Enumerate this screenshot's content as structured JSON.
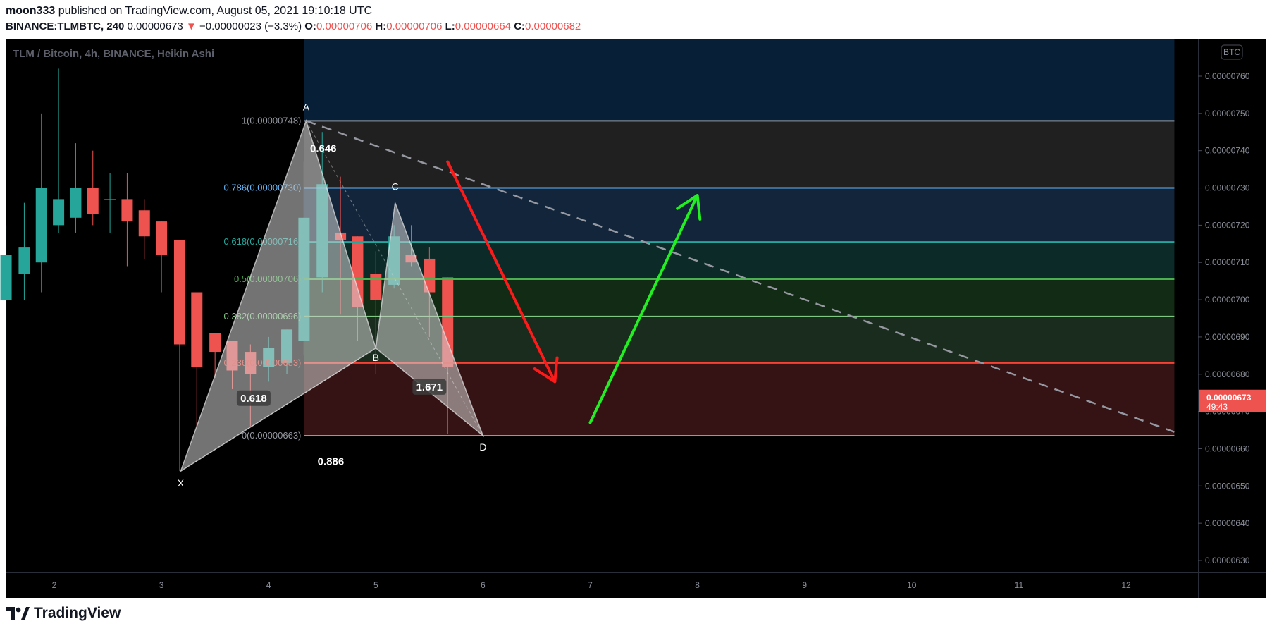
{
  "header": {
    "author": "moon333",
    "published_text": "published on TradingView.com, August 05, 2021 19:10:18 UTC",
    "symbol": "BINANCE:TLMBTC, 240",
    "last": "0.00000673",
    "change": "−0.00000023 (−3.3%)",
    "o_label": "O:",
    "o": "0.00000706",
    "h_label": "H:",
    "h": "0.00000706",
    "l_label": "L:",
    "l": "0.00000664",
    "c_label": "C:",
    "c": "0.00000682"
  },
  "footer": {
    "brand": "TradingView",
    "logo_icon": "tradingview-logo-icon"
  },
  "chart_data": {
    "type": "candlestick",
    "title": "TLM / Bitcoin, 4h, BINANCE, Heikin Ashi",
    "currency_badge": "BTC",
    "ylim": [
      6.26e-06,
      7.68e-06
    ],
    "x_ticks": [
      "2",
      "3",
      "4",
      "5",
      "6",
      "7",
      "8",
      "9",
      "10",
      "11",
      "12"
    ],
    "x_tick_days": [
      2,
      3,
      4,
      5,
      6,
      7,
      8,
      9,
      10,
      11,
      12
    ],
    "y_ticks": [
      "0.00000760",
      "0.00000750",
      "0.00000740",
      "0.00000730",
      "0.00000720",
      "0.00000710",
      "0.00000700",
      "0.00000690",
      "0.00000680",
      "0.00000670",
      "0.00000660",
      "0.00000650",
      "0.00000640",
      "0.00000630"
    ],
    "price_label": {
      "value": "0.00000673",
      "countdown": "49:43",
      "color": "#ef5350"
    },
    "candles": [
      {
        "t": 1.55,
        "o": 7.0,
        "h": 7.2,
        "l": 6.66,
        "c": 7.12
      },
      {
        "t": 1.72,
        "o": 7.07,
        "h": 7.26,
        "l": 7.0,
        "c": 7.14
      },
      {
        "t": 1.88,
        "o": 7.1,
        "h": 7.5,
        "l": 7.02,
        "c": 7.3
      },
      {
        "t": 2.04,
        "o": 7.2,
        "h": 7.62,
        "l": 7.18,
        "c": 7.27
      },
      {
        "t": 2.2,
        "o": 7.22,
        "h": 7.42,
        "l": 7.18,
        "c": 7.3
      },
      {
        "t": 2.36,
        "o": 7.3,
        "h": 7.4,
        "l": 7.2,
        "c": 7.23
      },
      {
        "t": 2.52,
        "o": 7.27,
        "h": 7.34,
        "l": 7.18,
        "c": 7.27
      },
      {
        "t": 2.68,
        "o": 7.27,
        "h": 7.34,
        "l": 7.09,
        "c": 7.21
      },
      {
        "t": 2.84,
        "o": 7.24,
        "h": 7.27,
        "l": 7.11,
        "c": 7.17
      },
      {
        "t": 3.0,
        "o": 7.21,
        "h": 7.21,
        "l": 7.02,
        "c": 7.12
      },
      {
        "t": 3.17,
        "o": 7.16,
        "h": 7.16,
        "l": 6.54,
        "c": 6.88
      },
      {
        "t": 3.33,
        "o": 7.02,
        "h": 7.02,
        "l": 6.66,
        "c": 6.82
      },
      {
        "t": 3.5,
        "o": 6.91,
        "h": 6.91,
        "l": 6.79,
        "c": 6.86
      },
      {
        "t": 3.66,
        "o": 6.89,
        "h": 6.89,
        "l": 6.76,
        "c": 6.81
      },
      {
        "t": 3.83,
        "o": 6.86,
        "h": 6.88,
        "l": 6.66,
        "c": 6.8
      },
      {
        "t": 4.0,
        "o": 6.82,
        "h": 6.9,
        "l": 6.78,
        "c": 6.87
      },
      {
        "t": 4.17,
        "o": 6.83,
        "h": 6.92,
        "l": 6.8,
        "c": 6.92
      },
      {
        "t": 4.33,
        "o": 6.89,
        "h": 7.37,
        "l": 6.85,
        "c": 7.22
      },
      {
        "t": 4.5,
        "o": 7.06,
        "h": 7.45,
        "l": 7.02,
        "c": 7.31
      },
      {
        "t": 4.67,
        "o": 7.18,
        "h": 7.33,
        "l": 6.96,
        "c": 7.16
      },
      {
        "t": 4.83,
        "o": 7.17,
        "h": 7.17,
        "l": 6.89,
        "c": 6.98
      },
      {
        "t": 5.0,
        "o": 7.07,
        "h": 7.13,
        "l": 6.8,
        "c": 7.0
      },
      {
        "t": 5.17,
        "o": 7.04,
        "h": 7.2,
        "l": 7.03,
        "c": 7.17
      },
      {
        "t": 5.33,
        "o": 7.12,
        "h": 7.2,
        "l": 7.09,
        "c": 7.1
      },
      {
        "t": 5.5,
        "o": 7.11,
        "h": 7.14,
        "l": 6.9,
        "c": 7.02
      },
      {
        "t": 5.67,
        "o": 7.06,
        "h": 7.06,
        "l": 6.64,
        "c": 6.82
      }
    ],
    "fib_levels": [
      {
        "label": "1(0.00000748)",
        "value": 7.48,
        "line": "#9598a1",
        "fill": "#202020"
      },
      {
        "label": "0.786(0.00000730)",
        "value": 7.3,
        "line": "#64b5f6",
        "fill": "#12253a"
      },
      {
        "label": "0.618(0.00000716)",
        "value": 7.155,
        "line": "#26a69a",
        "fill": "#0b2a28"
      },
      {
        "label": "0.5(0.00000706)",
        "value": 7.055,
        "line": "#4caf50",
        "fill": "#122b14"
      },
      {
        "label": "0.382(0.00000696)",
        "value": 6.955,
        "line": "#81c784",
        "fill": "#1a2c1d"
      },
      {
        "label": "0.236(0.00000683)",
        "value": 6.83,
        "line": "#f44336",
        "fill": "#351213"
      },
      {
        "label": "0(0.00000663)",
        "value": 6.635,
        "line": "#9598a1",
        "fill": null
      }
    ],
    "fib_top_fill": "#072037",
    "harmonic_points": [
      {
        "label": "X",
        "t": 3.18,
        "p": 6.54
      },
      {
        "label": "A",
        "t": 4.35,
        "p": 7.48
      },
      {
        "label": "B",
        "t": 5.0,
        "p": 6.87
      },
      {
        "label": "C",
        "t": 5.18,
        "p": 7.26
      },
      {
        "label": "D",
        "t": 6.0,
        "p": 6.635
      }
    ],
    "harmonic_ratios": [
      {
        "label": "0.646",
        "t": 4.51,
        "p": 7.4,
        "boxed": false
      },
      {
        "label": "0.618",
        "t": 3.86,
        "p": 6.73,
        "boxed": true
      },
      {
        "label": "0.886",
        "t": 4.58,
        "p": 6.56,
        "boxed": false
      },
      {
        "label": "1.671",
        "t": 5.5,
        "p": 6.76,
        "boxed": true
      }
    ],
    "trendline": {
      "t1": 4.35,
      "p1": 7.48,
      "t2": 12.45,
      "p2": 6.645,
      "color": "#9598a1"
    },
    "arrows": [
      {
        "color": "#ff1a1a",
        "t1": 5.67,
        "p1": 7.37,
        "t2": 6.67,
        "p2": 6.78
      },
      {
        "color": "#22ee22",
        "t1": 7.0,
        "p1": 6.67,
        "t2": 8.0,
        "p2": 7.28
      }
    ],
    "fib_start_t": 4.33,
    "fib_end_t": 12.45
  }
}
